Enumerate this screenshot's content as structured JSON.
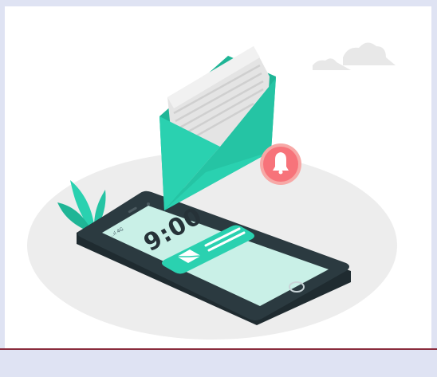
{
  "phone": {
    "clock": "9:00",
    "status": "..ıl 4G"
  },
  "colors": {
    "teal": "#2ad1b0",
    "teal_dark": "#1fb596",
    "phone_body": "#2b3a40",
    "screen": "#c9f0e7",
    "bell": "#f7737a",
    "platform": "#ececec",
    "background": "#dfe3f3"
  },
  "icons": [
    "envelope-icon",
    "bell-icon",
    "mail-icon",
    "home-button-icon",
    "cloud-icon",
    "plant-icon"
  ]
}
